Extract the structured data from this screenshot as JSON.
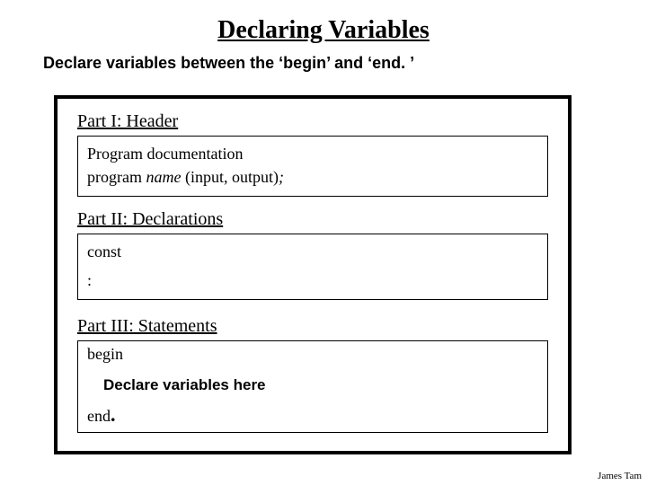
{
  "title": "Declaring Variables",
  "subtitle": "Declare variables between the ‘begin’ and ‘end. ’",
  "parts": {
    "header": {
      "heading": "Part I: Header",
      "doc_line": "Program documentation",
      "program_prefix": "program ",
      "program_name": "name",
      "program_suffix": " (input, output)",
      "program_semi": ";"
    },
    "declarations": {
      "heading": "Part II: Declarations",
      "const_kw": "const",
      "colon": ":"
    },
    "statements": {
      "heading": "Part III: Statements",
      "begin_kw": "begin",
      "declare_here": "Declare variables here",
      "end_kw": "end",
      "end_dot": "."
    }
  },
  "footer": "James Tam"
}
